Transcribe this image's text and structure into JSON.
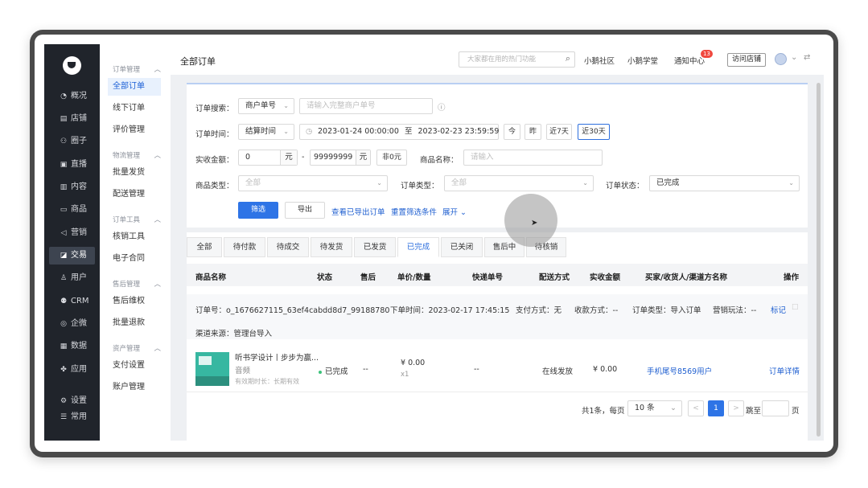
{
  "sidebar": {
    "items": [
      {
        "label": "概况",
        "icon": "dashboard-icon",
        "glyph": "◔"
      },
      {
        "label": "店铺",
        "icon": "store-icon",
        "glyph": "▤"
      },
      {
        "label": "圈子",
        "icon": "circle-group-icon",
        "glyph": "⚇"
      },
      {
        "label": "直播",
        "icon": "live-icon",
        "glyph": "▣"
      },
      {
        "label": "内容",
        "icon": "content-icon",
        "glyph": "▥"
      },
      {
        "label": "商品",
        "icon": "goods-icon",
        "glyph": "▭"
      },
      {
        "label": "营销",
        "icon": "marketing-icon",
        "glyph": "◁"
      },
      {
        "label": "交易",
        "icon": "trade-icon",
        "glyph": "◪"
      },
      {
        "label": "用户",
        "icon": "user-icon",
        "glyph": "♙"
      },
      {
        "label": "CRM",
        "icon": "crm-icon",
        "glyph": "⚉"
      },
      {
        "label": "企微",
        "icon": "wecom-icon",
        "glyph": "◎"
      },
      {
        "label": "数据",
        "icon": "data-icon",
        "glyph": "▦"
      },
      {
        "label": "应用",
        "icon": "apps-icon",
        "glyph": "✤"
      }
    ],
    "bottom": [
      {
        "label": "设置",
        "icon": "settings-icon",
        "glyph": "⚙"
      },
      {
        "label": "常用",
        "icon": "frequent-icon",
        "glyph": "☰"
      }
    ]
  },
  "subnav": {
    "groups": [
      {
        "title": "订单管理",
        "items": [
          "全部订单",
          "线下订单",
          "评价管理"
        ]
      },
      {
        "title": "物流管理",
        "items": [
          "批量发货",
          "配送管理"
        ]
      },
      {
        "title": "订单工具",
        "items": [
          "核销工具",
          "电子合同"
        ]
      },
      {
        "title": "售后管理",
        "items": [
          "售后维权",
          "批量退款"
        ]
      },
      {
        "title": "资产管理",
        "items": [
          "支付设置",
          "账户管理"
        ]
      }
    ]
  },
  "header": {
    "title": "全部订单",
    "search_placeholder": "大家都在用的热门功能",
    "links": [
      "小鹅社区",
      "小鹅学堂",
      "通知中心"
    ],
    "notify_count": "13",
    "visit_store": "访问店铺"
  },
  "filters": {
    "search_label": "订单搜索：",
    "search_type": "商户单号",
    "search_placeholder": "请输入完整商户单号",
    "time_label": "订单时间：",
    "time_type": "结算时间",
    "time_start": "2023-01-24 00:00:00",
    "time_sep": "至",
    "time_end": "2023-02-23 23:59:59",
    "quick_dates": [
      "今",
      "昨",
      "近7天",
      "近30天"
    ],
    "amount_label": "实收金额：",
    "amount_min": "0",
    "amount_unit": "元",
    "amount_dash": "-",
    "amount_max": "99999999",
    "nonzero": "非0元",
    "goods_name_label": "商品名称：",
    "goods_name_placeholder": "请输入",
    "goods_type_label": "商品类型：",
    "goods_type_value": "全部",
    "order_type_label": "订单类型：",
    "order_type_value": "全部",
    "order_status_label": "订单状态：",
    "order_status_value": "已完成",
    "filter_btn": "筛选",
    "export_btn": "导出",
    "view_exported": "查看已导出订单",
    "reset": "重置筛选条件",
    "expand": "展开"
  },
  "tabs": [
    "全部",
    "待付款",
    "待成交",
    "待发货",
    "已发货",
    "已完成",
    "已关闭",
    "售后中",
    "待核销"
  ],
  "active_tab": "已完成",
  "table": {
    "columns": [
      "商品名称",
      "状态",
      "售后",
      "单价/数量",
      "快递单号",
      "配送方式",
      "实收金额",
      "买家/收货人/渠道方名称",
      "操作"
    ],
    "order": {
      "order_no": "订单号：o_1676627115_63ef4cabdd8d7_99188780",
      "order_time": "下单时间：2023-02-17 17:45:15",
      "pay_method": "支付方式：无",
      "collect_method": "收款方式：--",
      "order_type": "订单类型：导入订单",
      "marketing": "营销玩法：--",
      "mark": "标记",
      "source": "渠道来源：管理台导入",
      "product_name": "听书学设计丨步步为赢...",
      "product_kind": "音频",
      "validity": "有效期时长：长期有效",
      "status": "已完成",
      "after_sale": "--",
      "price": "¥ 0.00",
      "qty": "x1",
      "express_no": "--",
      "delivery": "在线发放",
      "paid": "¥ 0.00",
      "buyer": "手机尾号8569用户",
      "action": "订单详情"
    }
  },
  "pagination": {
    "total": "共1条，每页",
    "page_size": "10 条",
    "current": "1",
    "prev": "<",
    "next": ">",
    "jump": "跳至",
    "page_unit": "页"
  }
}
